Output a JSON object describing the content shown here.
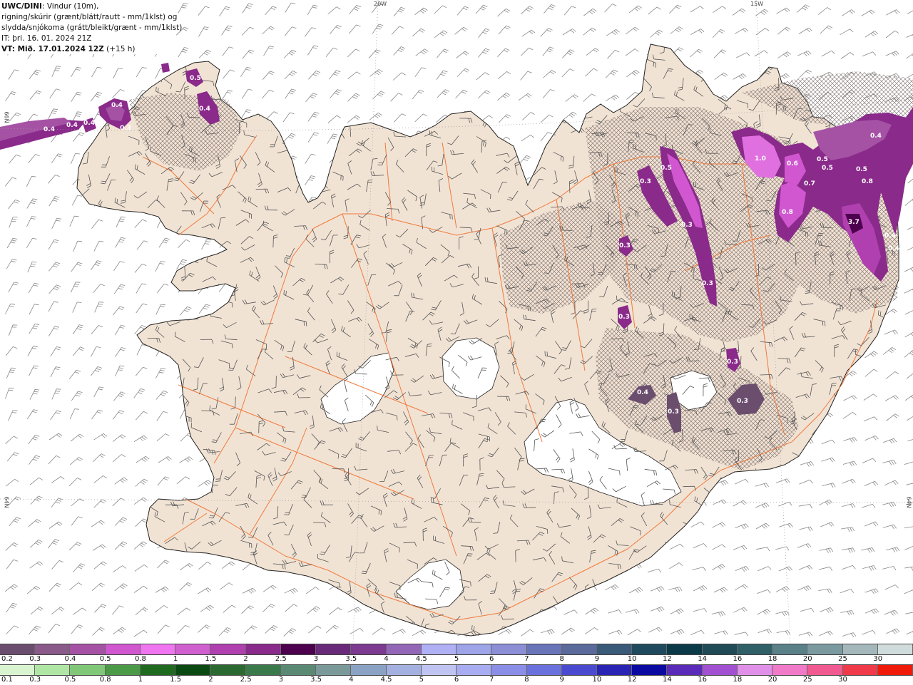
{
  "header": {
    "model": "UWC/DINI",
    "line1_rest": ": Vindur (10m),",
    "line2": "rigning/skúrir (grænt/blátt/rautt - mm/1klst) og",
    "line3": "slydda/snjókoma (grátt/bleikt/grænt - mm/1klst)",
    "issue_time": "IT: þri. 16. 01. 2024 21Z",
    "valid_time": "VT: Mið. 17.01.2024 12Z",
    "lead_time": "(+15 h)"
  },
  "grid_labels": {
    "lon_20w": "20W",
    "lon_15w": "15W",
    "lat_left_66": "66N",
    "lat_left_64": "64N",
    "lat_right_64": "64N"
  },
  "snow_scale": {
    "labels": [
      "0.2",
      "0.3",
      "0.4",
      "0.5",
      "0.8",
      "1",
      "1.5",
      "2",
      "2.5",
      "3",
      "3.5",
      "4",
      "4.5",
      "5",
      "6",
      "7",
      "8",
      "9",
      "10",
      "12",
      "14",
      "16",
      "18",
      "20",
      "25",
      "30"
    ],
    "colors": [
      "#6b4e6e",
      "#8a5a8a",
      "#a552a5",
      "#d057d0",
      "#f075f0",
      "#d060d0",
      "#b040b0",
      "#8a2a8a",
      "#4d004d",
      "#6a2a7a",
      "#7c3a90",
      "#9466b8",
      "#b0b0f5",
      "#9ea4e8",
      "#8c8ed6",
      "#6a74b8",
      "#5a6a9a",
      "#3a5a7a",
      "#1f4a5e",
      "#0a3a48",
      "#1f4a56",
      "#2f6068",
      "#5a8088",
      "#7a9aa0",
      "#a4b8bc",
      "#d0dcdc"
    ]
  },
  "rain_scale": {
    "labels": [
      "0.1",
      "0.3",
      "0.5",
      "0.8",
      "1",
      "1.5",
      "2",
      "2.5",
      "3",
      "3.5",
      "4",
      "4.5",
      "5",
      "6",
      "7",
      "8",
      "9",
      "10",
      "12",
      "14",
      "16",
      "18",
      "20",
      "25",
      "30"
    ],
    "colors": [
      "#d8f5d0",
      "#b0e6a4",
      "#80c878",
      "#4a9a48",
      "#1e6a1e",
      "#0a4a12",
      "#2a6a30",
      "#3a7a4a",
      "#5a8a74",
      "#7a9a9a",
      "#8aa2c4",
      "#a4b0e0",
      "#c0c4f2",
      "#a8acf0",
      "#8a8ee6",
      "#6a70dc",
      "#4a4ad0",
      "#2a24b4",
      "#0a0aa0",
      "#5a2ab8",
      "#a050d0",
      "#e090e8",
      "#f07ac8",
      "#f05a90",
      "#f03a4a",
      "#f01a0a"
    ]
  },
  "precip_labels": [
    {
      "t": "0.4"
    },
    {
      "t": "0.4"
    },
    {
      "t": "0.4"
    },
    {
      "t": "0.4"
    },
    {
      "t": "0.3"
    },
    {
      "t": "0.5"
    },
    {
      "t": "0.4"
    },
    {
      "t": "0.3"
    },
    {
      "t": "0.5"
    },
    {
      "t": "0.3"
    },
    {
      "t": "0.3"
    },
    {
      "t": "0.3"
    },
    {
      "t": "0.3"
    },
    {
      "t": "0.3"
    },
    {
      "t": "0.4"
    },
    {
      "t": "0.3"
    },
    {
      "t": "0.3"
    },
    {
      "t": "1.0"
    },
    {
      "t": "0.6"
    },
    {
      "t": "0.7"
    },
    {
      "t": "0.5"
    },
    {
      "t": "0.5"
    },
    {
      "t": "0.5"
    },
    {
      "t": "0.8"
    },
    {
      "t": "0.4"
    },
    {
      "t": "0.8"
    },
    {
      "t": "3.7"
    },
    {
      "t": "0.4"
    },
    {
      "t": "0.4"
    }
  ],
  "colors": {
    "land": "#f1e3d4",
    "roads": "#f07a3c",
    "coast": "#222222",
    "barbs": "#444444",
    "ocean": "#ffffff",
    "glacier": "#ffffff",
    "gridline": "#999999"
  }
}
